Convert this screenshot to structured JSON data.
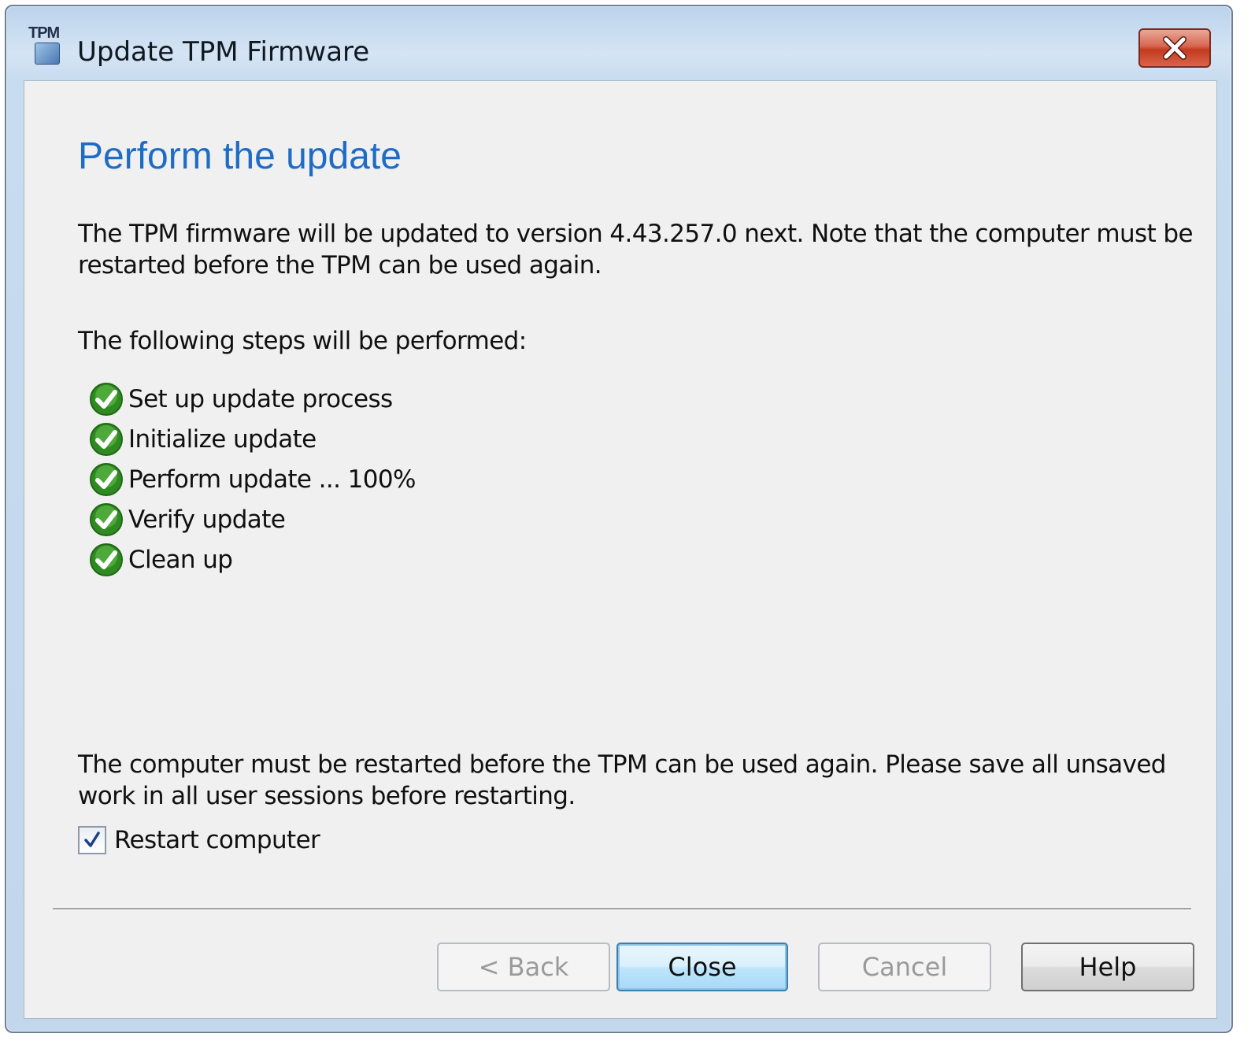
{
  "window": {
    "title": "Update TPM Firmware",
    "app_icon_text": "TPM",
    "close_icon": "close-x-icon"
  },
  "content": {
    "heading": "Perform the update",
    "intro": "The TPM firmware will be updated to version 4.43.257.0 next. Note that the computer must be restarted before the TPM can be used again.",
    "steps_label": "The following steps will be performed:",
    "steps": [
      {
        "label": "Set up update process",
        "status": "completed",
        "icon": "green-check-icon"
      },
      {
        "label": "Initialize update",
        "status": "completed",
        "icon": "green-check-icon"
      },
      {
        "label": "Perform update ... 100%",
        "status": "completed",
        "icon": "green-check-icon"
      },
      {
        "label": "Verify update",
        "status": "completed",
        "icon": "green-check-icon"
      },
      {
        "label": "Clean up",
        "status": "completed",
        "icon": "green-check-icon"
      }
    ],
    "restart_notice": "The computer must be restarted before the TPM can be used again. Please save all unsaved work in all user sessions before restarting.",
    "restart_checkbox": {
      "label": "Restart computer",
      "checked": true
    }
  },
  "buttons": {
    "back": {
      "label": "< Back",
      "enabled": false
    },
    "close": {
      "label": "Close",
      "enabled": true,
      "default": true
    },
    "cancel": {
      "label": "Cancel",
      "enabled": false
    },
    "help": {
      "label": "Help",
      "enabled": true
    }
  },
  "colors": {
    "heading": "#1f6cc6",
    "check_green": "#3c9b2d",
    "client_bg": "#f0f0f0",
    "close_button_red": "#c23a20"
  }
}
